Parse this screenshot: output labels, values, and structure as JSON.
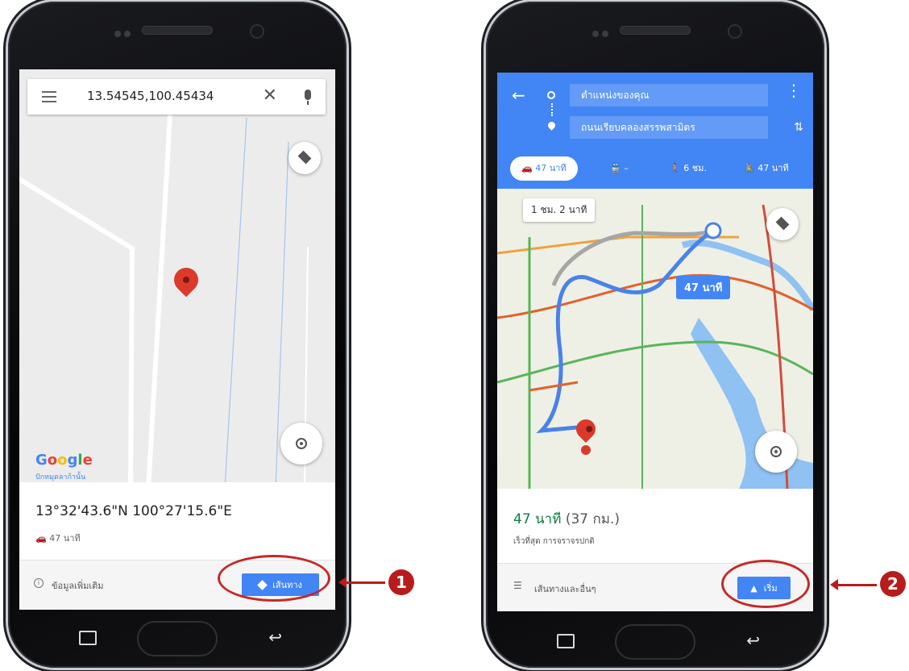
{
  "left_phone": {
    "search": {
      "value": "13.54545,100.45434"
    },
    "google_logo": "Google",
    "map_caption": "ปักหมุดลาก้านั้น",
    "place": {
      "coordinates": "13°32'43.6\"N 100°27'15.6\"E",
      "drive_time": "47 นาที"
    },
    "actions": {
      "more_info_label": "ข้อมูลเพิ่มเติม",
      "directions_label": "เส้นทาง"
    },
    "callout_number": "1"
  },
  "right_phone": {
    "origin_label": "ตำแหน่งของคุณ",
    "destination_label": "ถนนเรียบคลองสรรพสามิตร",
    "modes": [
      {
        "name": "car-icon",
        "label": "47 นาที",
        "active": true
      },
      {
        "name": "transit-icon",
        "label": "–",
        "active": false
      },
      {
        "name": "walk-icon",
        "label": "6 ชม.",
        "active": false
      },
      {
        "name": "bike-icon",
        "label": "47 นาที",
        "active": false
      }
    ],
    "map": {
      "alt_route_label": "1 ชม. 2 นาที",
      "main_route_label": "47 นาที"
    },
    "route": {
      "time": "47 นาที",
      "distance": "(37 กม.)",
      "subtitle": "เร็วที่สุด การจราจรปกติ"
    },
    "actions": {
      "steps_label": "เส้นทางและอื่นๆ",
      "start_label": "เริ่ม"
    },
    "callout_number": "2"
  },
  "colors": {
    "accent": "#4285f4",
    "callout": "#b71c1c",
    "pin": "#db3a2b",
    "eta_green": "#0b8043"
  }
}
